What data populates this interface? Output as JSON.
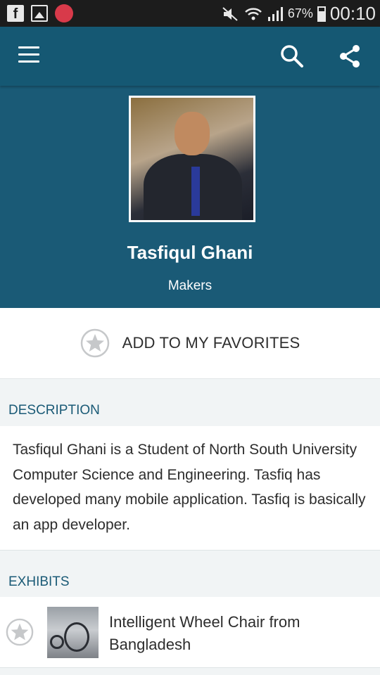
{
  "status_bar": {
    "battery": "67%",
    "time": "00:10",
    "icons": [
      "facebook-icon",
      "gallery-icon",
      "red-circle-app-icon",
      "mute-icon",
      "wifi-icon",
      "signal-icon",
      "battery-icon"
    ]
  },
  "app_bar": {
    "icons": [
      "menu-icon",
      "search-icon",
      "share-icon"
    ],
    "color": "#155873"
  },
  "profile": {
    "name": "Tasfiqul Ghani",
    "role": "Makers"
  },
  "favorites": {
    "label": "ADD TO MY FAVORITES",
    "icon": "star-icon"
  },
  "description": {
    "title": "DESCRIPTION",
    "text": "Tasfiqul Ghani is a Student of North South University Computer Science and Engineering. Tasfiq has developed many mobile application. Tasfiq is basically an app developer."
  },
  "exhibits": {
    "title": "EXHIBITS",
    "items": [
      {
        "name": "Intelligent Wheel Chair from Bangladesh",
        "icon": "star-icon"
      }
    ]
  }
}
